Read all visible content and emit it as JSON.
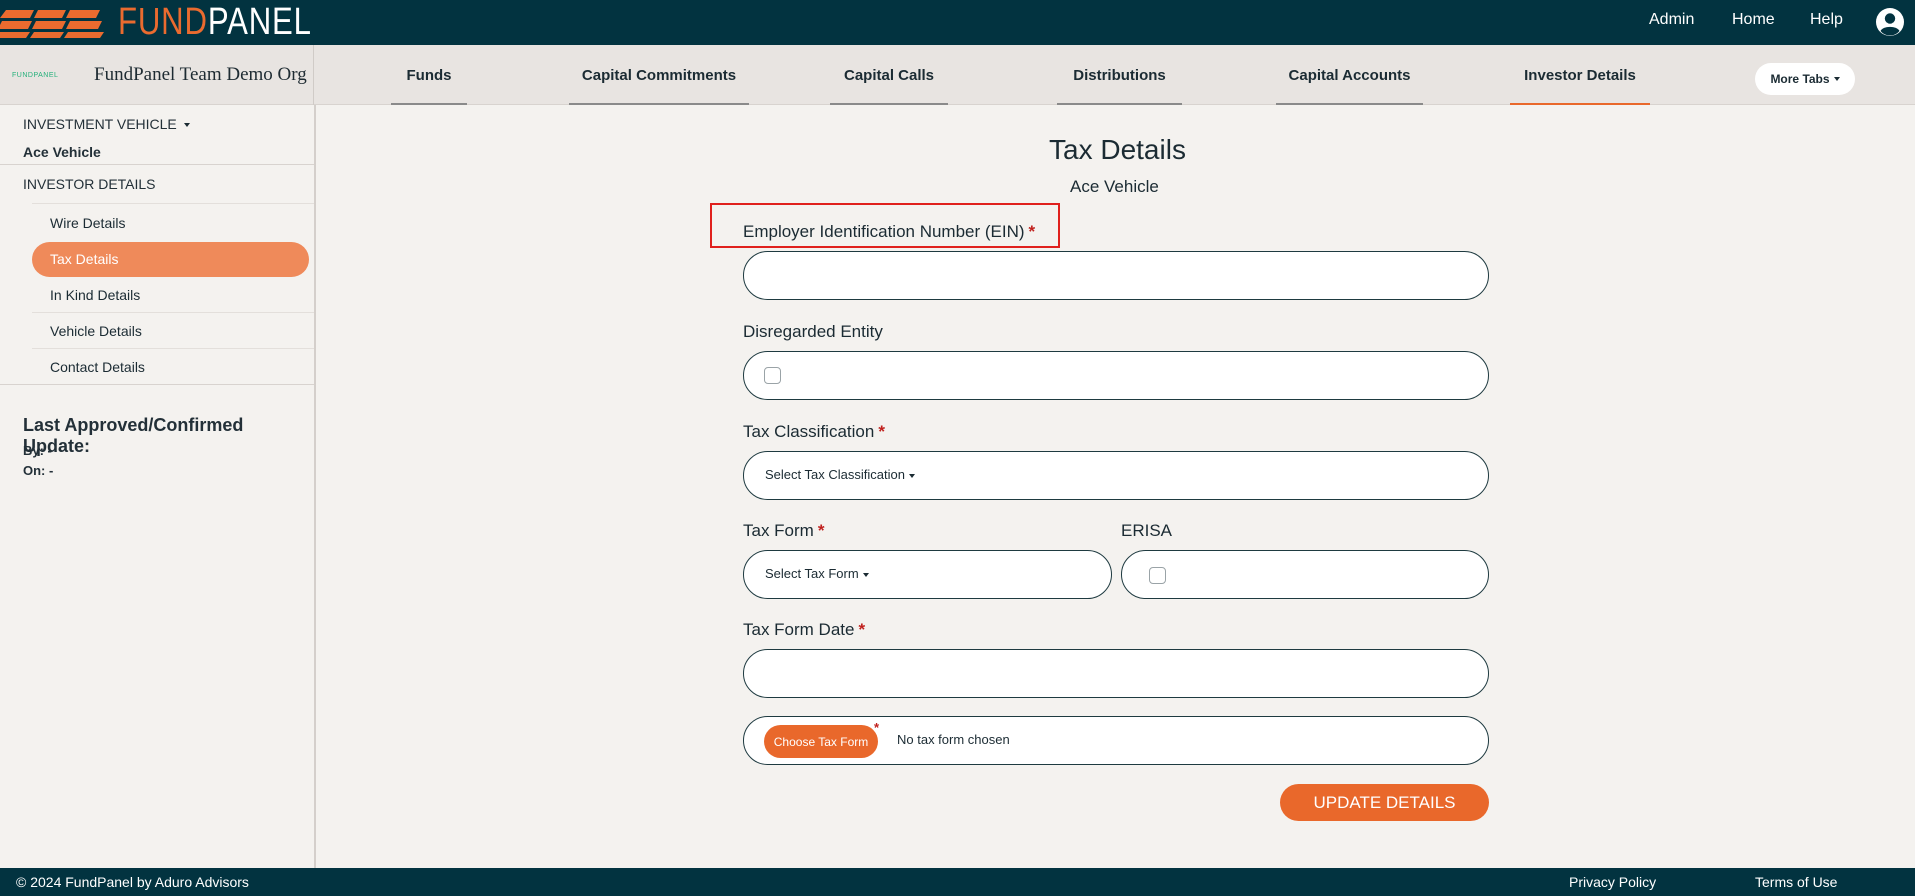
{
  "brand": {
    "part1": "FUND",
    "part2": "PANEL",
    "mini": "FUNDPANEL"
  },
  "topnav": {
    "admin": "Admin",
    "home": "Home",
    "help": "Help"
  },
  "org": {
    "name": "FundPanel Team Demo Org"
  },
  "tabs": [
    {
      "label": "Funds"
    },
    {
      "label": "Capital Commitments"
    },
    {
      "label": "Capital Calls"
    },
    {
      "label": "Distributions"
    },
    {
      "label": "Capital Accounts"
    },
    {
      "label": "Investor Details"
    }
  ],
  "more_tabs": "More Tabs",
  "sidebar": {
    "vehicle_heading": "INVESTMENT VEHICLE",
    "vehicle_name": "Ace Vehicle",
    "details_heading": "INVESTOR DETAILS",
    "items": [
      "Wire Details",
      "Tax Details",
      "In Kind Details",
      "Vehicle Details",
      "Contact Details"
    ],
    "active_item": "Tax Details",
    "last_update_title": "Last Approved/Confirmed Update:",
    "by": "By: -",
    "on": "On: -"
  },
  "form": {
    "title": "Tax Details",
    "subtitle": "Ace Vehicle",
    "ein_label": "Employer Identification Number (EIN)",
    "disregarded_label": "Disregarded Entity",
    "tax_class_label": "Tax Classification",
    "tax_class_select": "Select Tax Classification",
    "tax_form_label": "Tax Form",
    "tax_form_select": "Select Tax Form",
    "erisa_label": "ERISA",
    "tax_form_date_label": "Tax Form Date",
    "choose_button": "Choose Tax Form",
    "no_file": "No tax form chosen",
    "required_mark": "*",
    "update_button": "UPDATE DETAILS"
  },
  "footer": {
    "copyright": "© 2024 FundPanel by Aduro Advisors",
    "privacy": "Privacy Policy",
    "terms": "Terms of Use"
  },
  "colors": {
    "navy": "#023340",
    "accent": "#e9682b",
    "background": "#f4f2ef"
  }
}
